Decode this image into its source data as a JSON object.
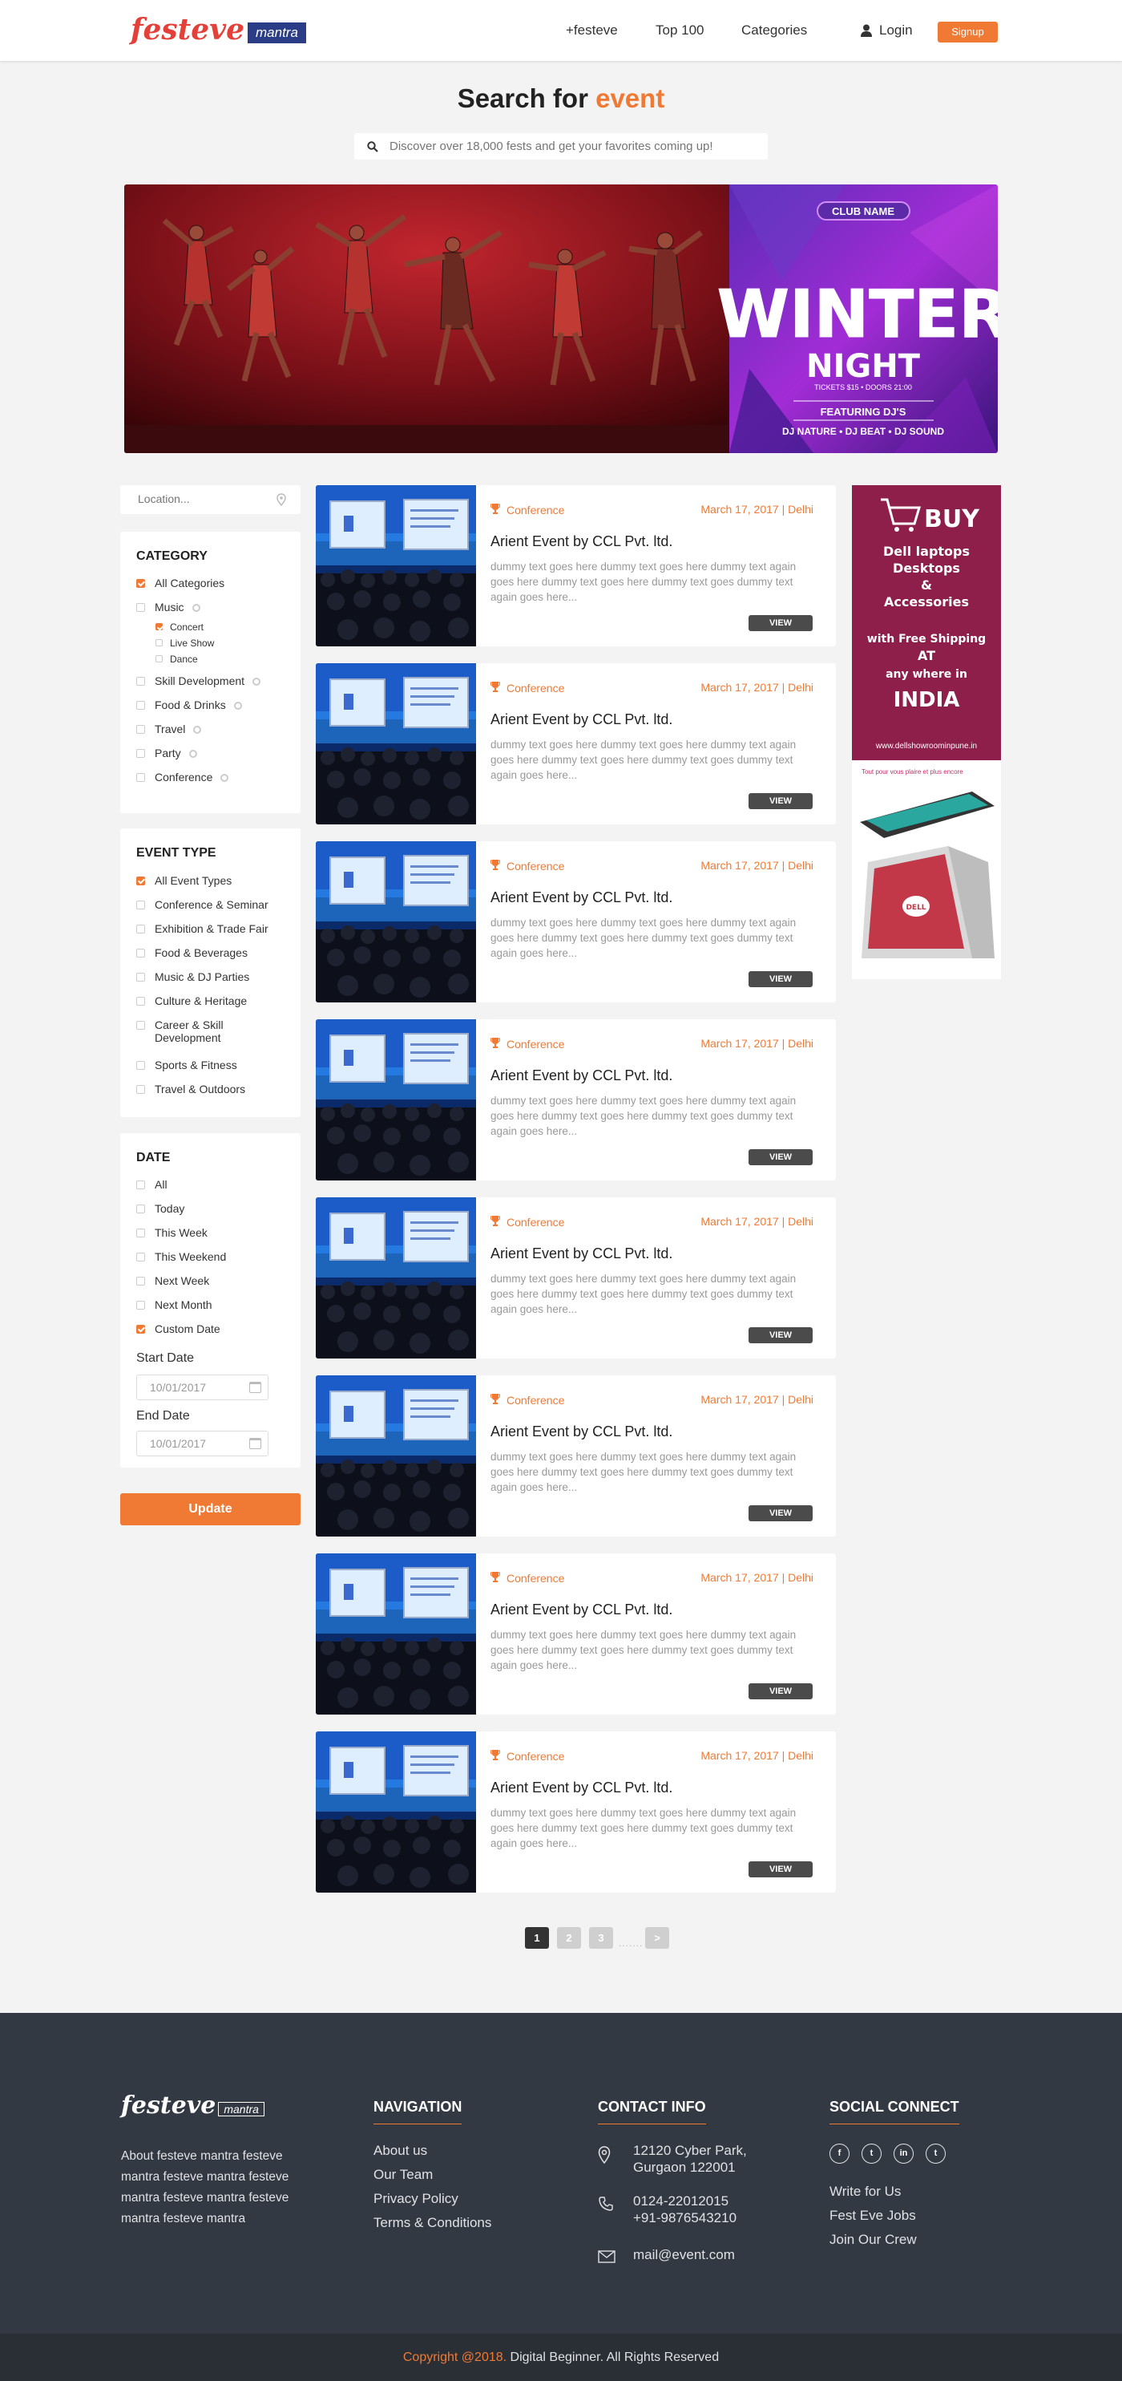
{
  "brand": {
    "name": "festeve",
    "sub": "mantra"
  },
  "nav": {
    "items": [
      "+festeve",
      "Top 100",
      "Categories"
    ],
    "login": "Login",
    "signup": "Signup"
  },
  "hero": {
    "title_prefix": "Search for ",
    "title_accent": "event",
    "search_placeholder": "Discover over 18,000 fests and get your favorites coming up!"
  },
  "banner": {
    "club_name": "CLUB NAME",
    "line1": "WINTER",
    "line2": "NIGHT",
    "tickets": "TICKETS $15 • DOORS 21:00",
    "featuring": "FEATURING DJ'S",
    "djs": "DJ NATURE • DJ BEAT • DJ SOUND"
  },
  "sidebar": {
    "location_placeholder": "Location...",
    "category": {
      "title": "CATEGORY",
      "all": "All Categories",
      "music": "Music",
      "music_sub": [
        "Concert",
        "Live Show",
        "Dance"
      ],
      "others": [
        "Skill Development",
        "Food & Drinks",
        "Travel",
        "Party",
        "Conference"
      ]
    },
    "event_type": {
      "title": "EVENT TYPE",
      "items": [
        "All Event Types",
        "Conference & Seminar",
        "Exhibition & Trade Fair",
        "Food & Beverages",
        "Music & DJ Parties",
        "Culture & Heritage",
        "Career & Skill Development",
        "Sports & Fitness",
        "Travel & Outdoors"
      ]
    },
    "date": {
      "title": "DATE",
      "items": [
        "All",
        "Today",
        "This Week",
        "This Weekend",
        "Next Week",
        "Next Month",
        "Custom Date"
      ],
      "start_label": "Start Date",
      "start_value": "10/01/2017",
      "end_label": "End Date",
      "end_value": "10/01/2017"
    },
    "update": "Update"
  },
  "events": [
    {
      "category": "Conference",
      "date": "March 17, 2017 | Delhi",
      "title": "Arient Event by CCL Pvt. ltd.",
      "desc": "dummy text goes here dummy text goes here dummy text again goes here dummy text goes here dummy text goes dummy text again goes here...",
      "view": "VIEW"
    },
    {
      "category": "Conference",
      "date": "March 17, 2017 | Delhi",
      "title": "Arient Event by CCL Pvt. ltd.",
      "desc": "dummy text goes here dummy text goes here dummy text again goes here dummy text goes here dummy text goes dummy text again goes here...",
      "view": "VIEW"
    },
    {
      "category": "Conference",
      "date": "March 17, 2017 | Delhi",
      "title": "Arient Event by CCL Pvt. ltd.",
      "desc": "dummy text goes here dummy text goes here dummy text again goes here dummy text goes here dummy text goes dummy text again goes here...",
      "view": "VIEW"
    },
    {
      "category": "Conference",
      "date": "March 17, 2017 | Delhi",
      "title": "Arient Event by CCL Pvt. ltd.",
      "desc": "dummy text goes here dummy text goes here dummy text again goes here dummy text goes here dummy text goes dummy text again goes here...",
      "view": "VIEW"
    },
    {
      "category": "Conference",
      "date": "March 17, 2017 | Delhi",
      "title": "Arient Event by CCL Pvt. ltd.",
      "desc": "dummy text goes here dummy text goes here dummy text again goes here dummy text goes here dummy text goes dummy text again goes here...",
      "view": "VIEW"
    },
    {
      "category": "Conference",
      "date": "March 17, 2017 | Delhi",
      "title": "Arient Event by CCL Pvt. ltd.",
      "desc": "dummy text goes here dummy text goes here dummy text again goes here dummy text goes here dummy text goes dummy text again goes here...",
      "view": "VIEW"
    },
    {
      "category": "Conference",
      "date": "March 17, 2017 | Delhi",
      "title": "Arient Event by CCL Pvt. ltd.",
      "desc": "dummy text goes here dummy text goes here dummy text again goes here dummy text goes here dummy text goes dummy text again goes here...",
      "view": "VIEW"
    },
    {
      "category": "Conference",
      "date": "March 17, 2017 | Delhi",
      "title": "Arient Event by CCL Pvt. ltd.",
      "desc": "dummy text goes here dummy text goes here dummy text again goes here dummy text goes here dummy text goes dummy text again goes here...",
      "view": "VIEW"
    }
  ],
  "ad": {
    "buy": "BUY",
    "line1": "Dell laptops",
    "line2": "Desktops",
    "line3": "&",
    "line4": "Accessories",
    "line5": "with Free Shipping",
    "line6": "AT",
    "line7": "any where in",
    "line8": "INDIA",
    "url": "www.dellshowroominpune.in",
    "tagline": "Tout pour vous plaire et plus encore",
    "brand": "DELL"
  },
  "pagination": {
    "pages": [
      "1",
      "2",
      "3"
    ],
    "dots": ".......",
    "next": ">"
  },
  "footer": {
    "about": "About festeve mantra festeve mantra  festeve mantra festeve mantra festeve mantra festeve mantra festeve mantra",
    "nav_title": "NAVIGATION",
    "nav_links": [
      "About us",
      "Our Team",
      "Privacy Policy",
      "Terms & Conditions"
    ],
    "contact_title": "CONTACT INFO",
    "address": [
      "12120 Cyber Park,",
      "Gurgaon 122001"
    ],
    "phones": [
      "0124-22012015",
      "+91-9876543210"
    ],
    "email": "mail@event.com",
    "social_title": "SOCIAL CONNECT",
    "social_icons": [
      "f",
      "t",
      "in",
      "t"
    ],
    "social_links": [
      "Write for Us",
      "Fest Eve Jobs",
      "Join Our Crew"
    ],
    "copyright_accent": "Copyright @2018.",
    "copyright_rest": " Digital Beginner. All Rights Reserved"
  },
  "colors": {
    "accent": "#f07a34",
    "footer_bg": "#333943",
    "bottom_bg": "#2a2e35"
  }
}
